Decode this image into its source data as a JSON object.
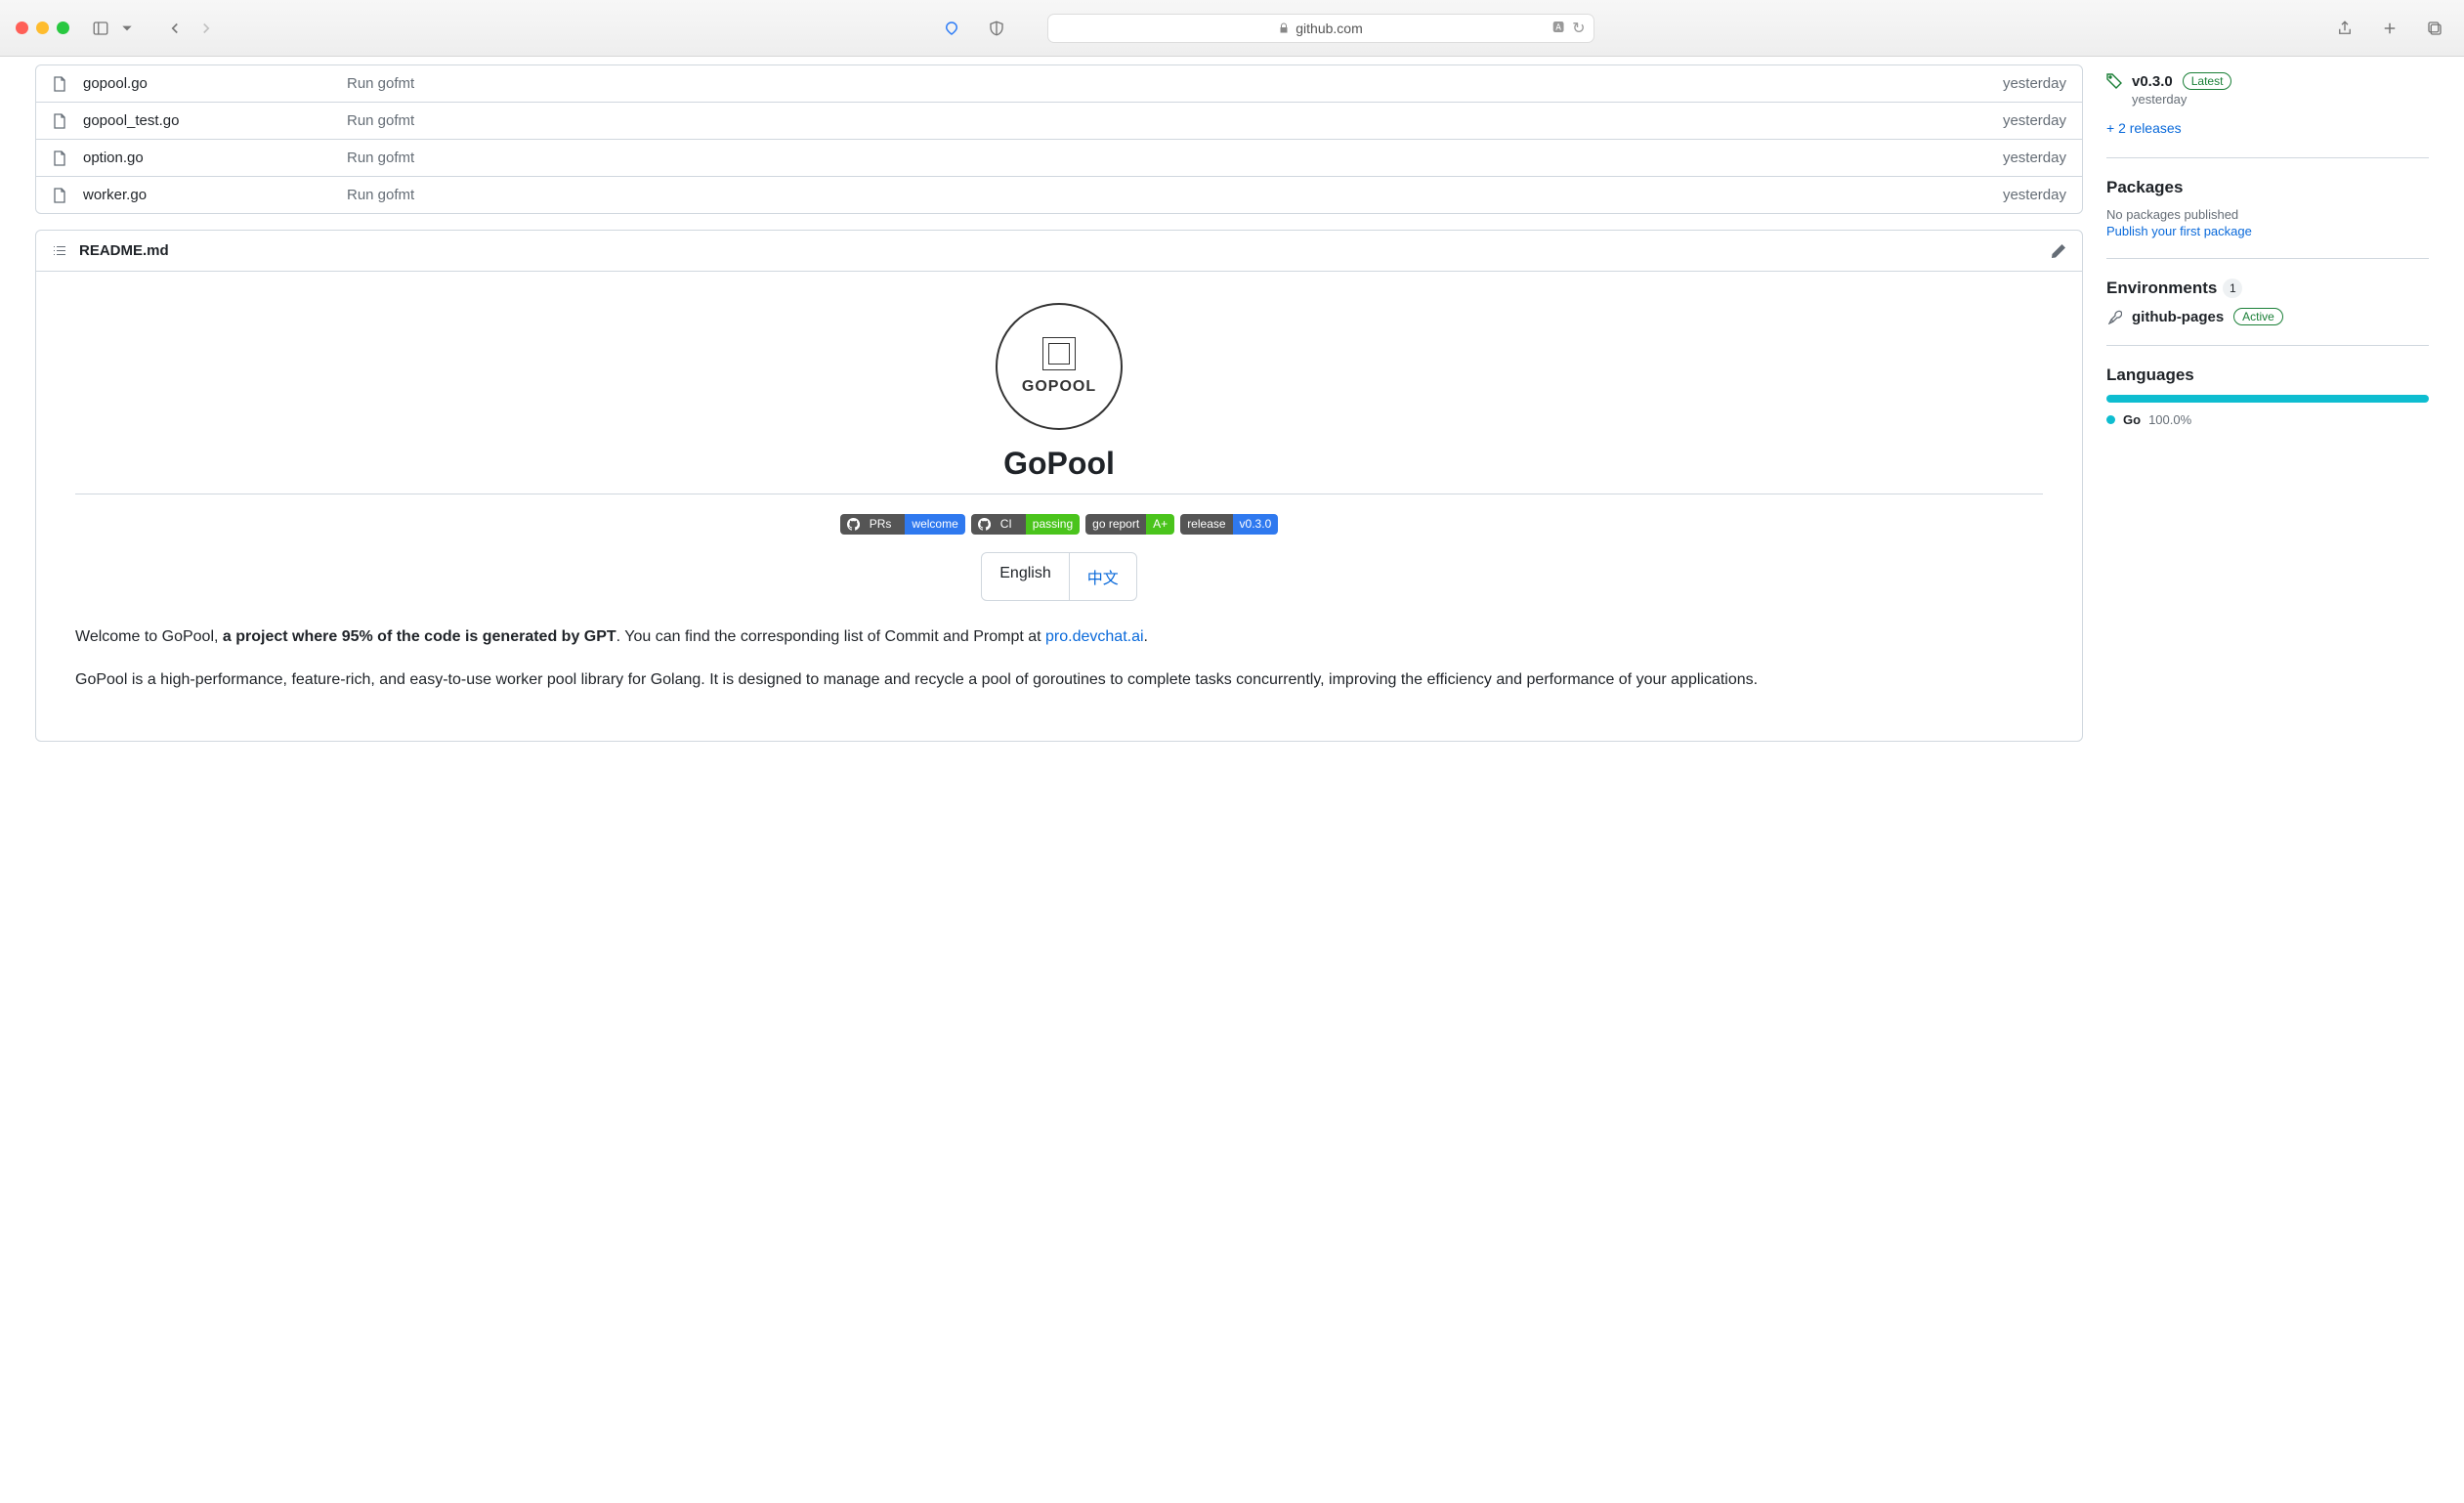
{
  "browser": {
    "domain": "github.com"
  },
  "files": [
    {
      "name": "gopool.go",
      "commit": "Run gofmt",
      "date": "yesterday"
    },
    {
      "name": "gopool_test.go",
      "commit": "Run gofmt",
      "date": "yesterday"
    },
    {
      "name": "option.go",
      "commit": "Run gofmt",
      "date": "yesterday"
    },
    {
      "name": "worker.go",
      "commit": "Run gofmt",
      "date": "yesterday"
    }
  ],
  "readme": {
    "filename": "README.md",
    "logo_text": "GOPOOL",
    "title": "GoPool",
    "badges": {
      "prs_left": "PRs",
      "prs_right": "welcome",
      "ci_left": "CI",
      "ci_right": "passing",
      "report_left": "go report",
      "report_right": "A+",
      "release_left": "release",
      "release_right": "v0.3.0"
    },
    "lang_en": "English",
    "lang_zh": "中文",
    "intro_prefix": "Welcome to GoPool, ",
    "intro_bold": "a project where 95% of the code is generated by GPT",
    "intro_after": ". You can find the corresponding list of Commit and Prompt at ",
    "intro_link": "pro.devchat.ai",
    "intro_period": ".",
    "para2": "GoPool is a high-performance, feature-rich, and easy-to-use worker pool library for Golang. It is designed to manage and recycle a pool of goroutines to complete tasks concurrently, improving the efficiency and performance of your applications."
  },
  "sidebar": {
    "release_version": "v0.3.0",
    "release_latest": "Latest",
    "release_date": "yesterday",
    "more_releases": "+ 2 releases",
    "packages_title": "Packages",
    "packages_empty": "No packages published",
    "packages_link": "Publish your first package",
    "env_title": "Environments",
    "env_count": "1",
    "env_name": "github-pages",
    "env_status": "Active",
    "lang_title": "Languages",
    "lang_name": "Go",
    "lang_pct": "100.0%"
  }
}
